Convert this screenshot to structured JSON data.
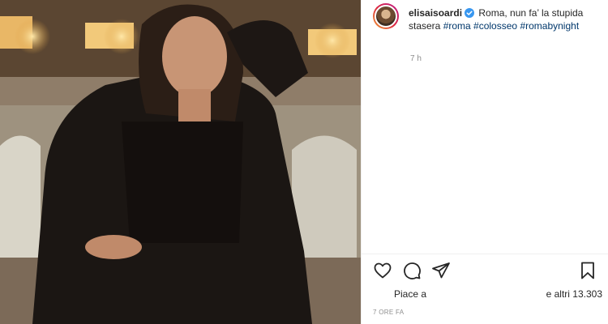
{
  "post": {
    "username": "elisaisoardi",
    "verified_icon": "verified-badge-icon",
    "caption_text": " Roma, nun fa’ la stupida stasera ",
    "hashtags": [
      "#roma",
      "#colosseo",
      "#romabynight"
    ],
    "time_ago": "7 h",
    "likes_prefix": "Piace a",
    "likes_suffix": "e altri 13.303",
    "timestamp": "7 ORE FA"
  },
  "actions": {
    "like_icon": "heart-icon",
    "comment_icon": "comment-icon",
    "share_icon": "paper-plane-icon",
    "save_icon": "bookmark-icon"
  },
  "colors": {
    "hashtag": "#00376b",
    "verified": "#3897f0",
    "muted": "#8e8e8e",
    "text": "#262626"
  }
}
